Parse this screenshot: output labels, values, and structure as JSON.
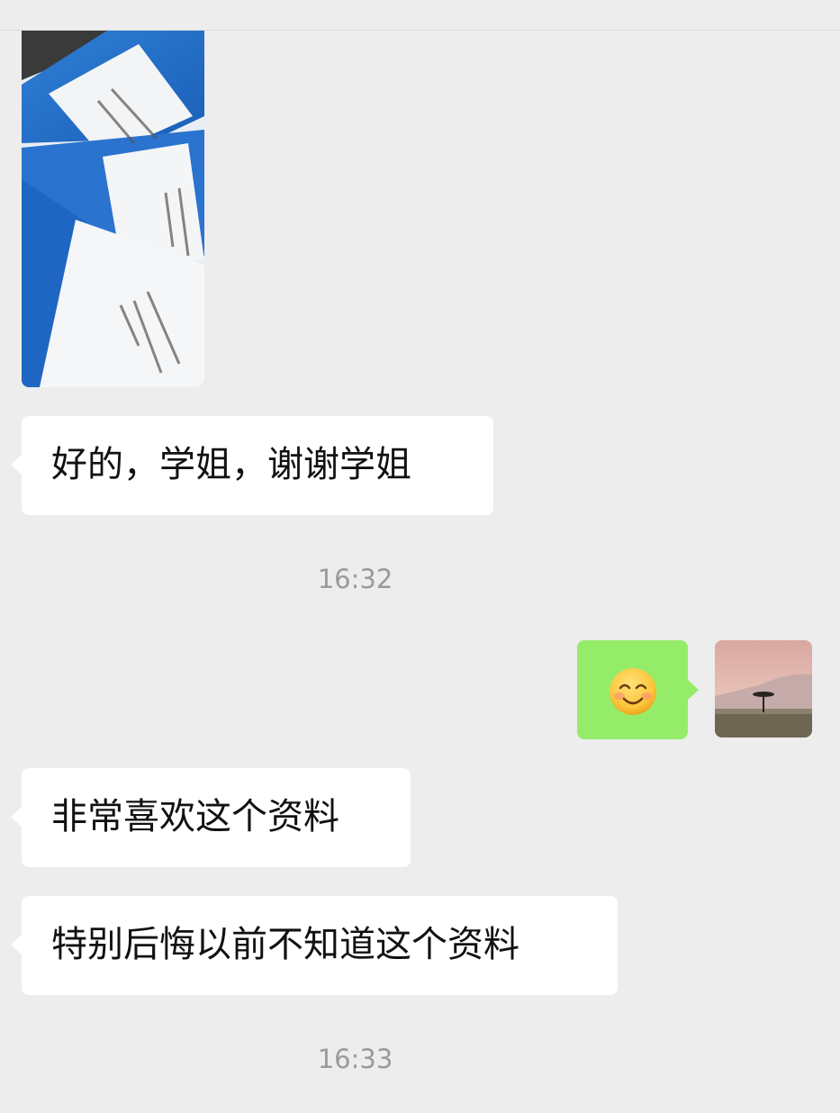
{
  "messages": [
    {
      "id": "m1",
      "direction": "incoming",
      "type": "image",
      "content": "photo of nursing study booklets"
    },
    {
      "id": "m2",
      "direction": "incoming",
      "type": "text",
      "text": "好的，学姐，谢谢学姐"
    },
    {
      "id": "ts1",
      "type": "timestamp",
      "text": "16:32"
    },
    {
      "id": "m3",
      "direction": "outgoing",
      "type": "emoji",
      "emoji": "smiling-face-icon"
    },
    {
      "id": "m4",
      "direction": "incoming",
      "type": "text",
      "text": "非常喜欢这个资料"
    },
    {
      "id": "m5",
      "direction": "incoming",
      "type": "text",
      "text": "特别后悔以前不知道这个资料"
    },
    {
      "id": "ts2",
      "type": "timestamp",
      "text": "16:33"
    }
  ],
  "colors": {
    "background": "#ededed",
    "incoming_bubble": "#ffffff",
    "outgoing_bubble": "#95ec69",
    "timestamp_text": "#9a9a9a",
    "message_text": "#111111"
  }
}
